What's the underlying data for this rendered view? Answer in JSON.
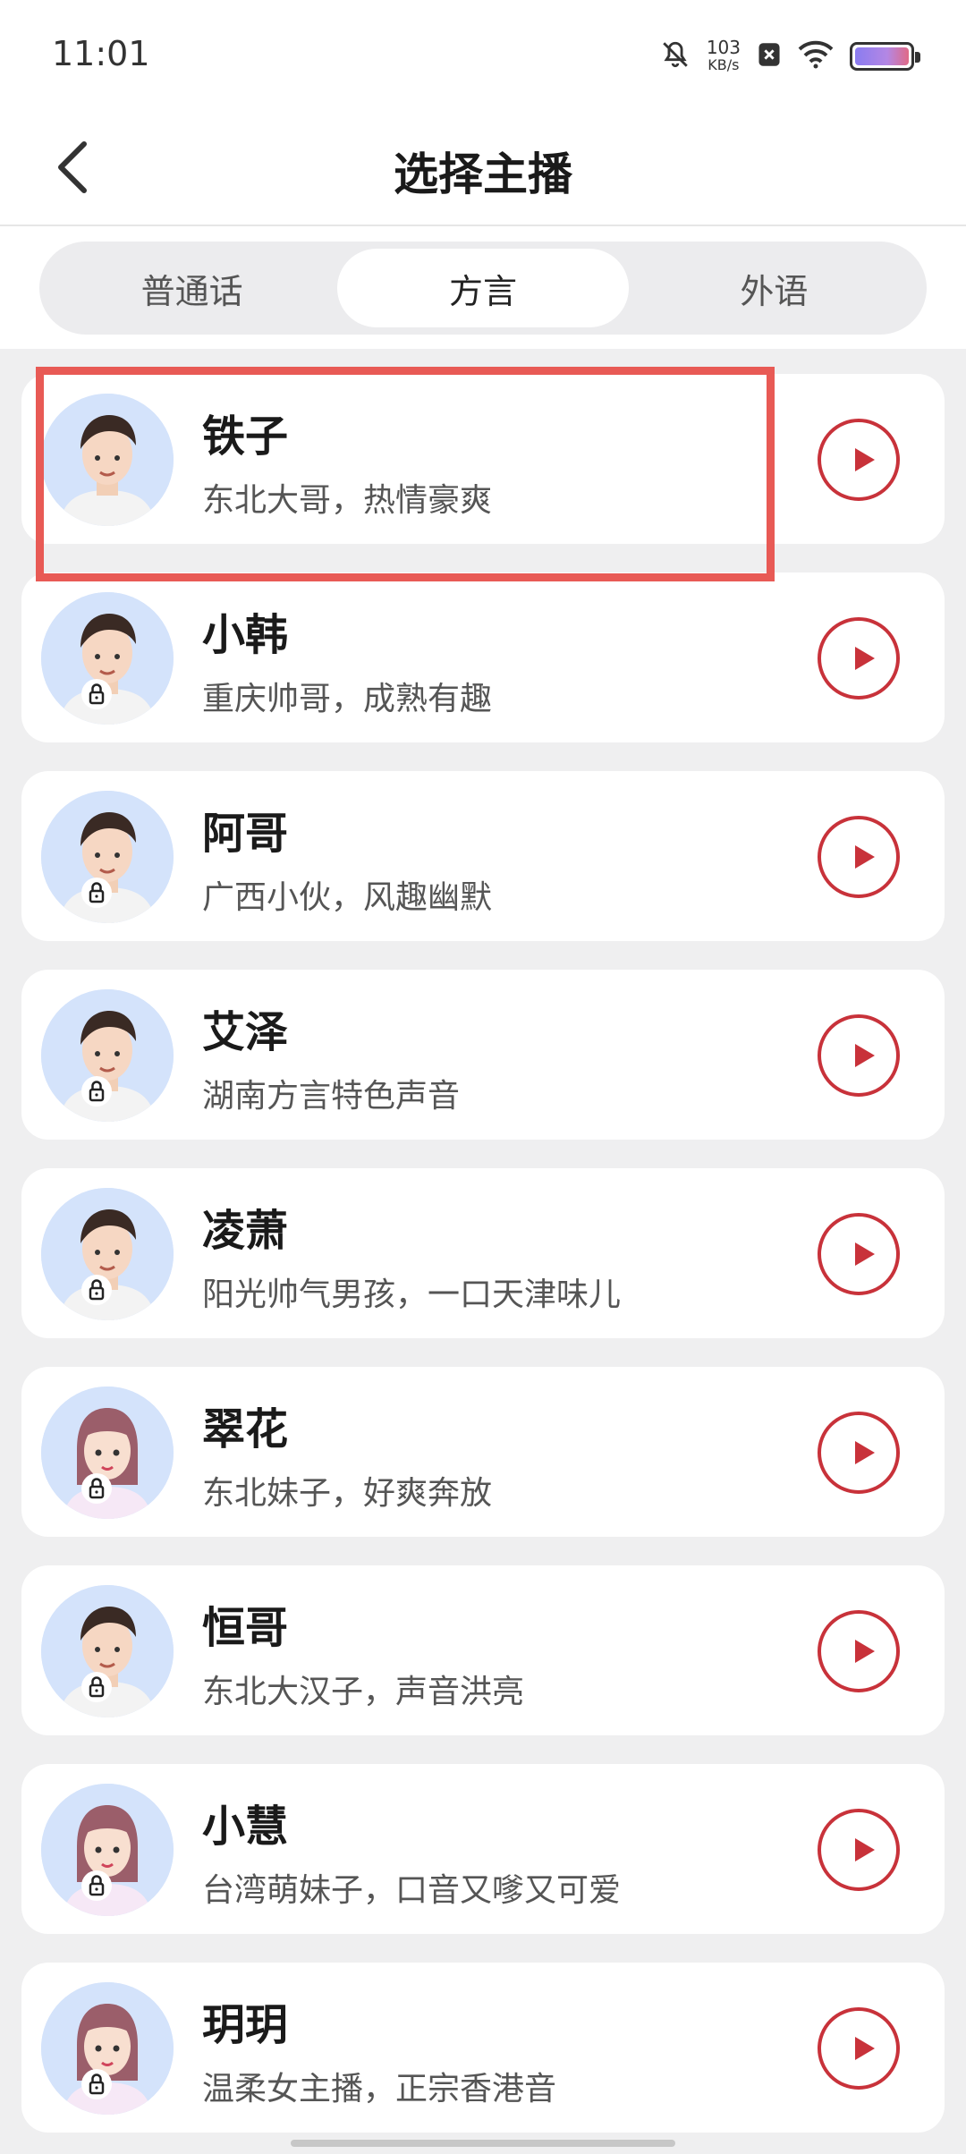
{
  "status_bar": {
    "time": "11:01",
    "speed_value": "103",
    "speed_unit": "KB/s",
    "icons": [
      "mute-bell-icon",
      "x-badge-icon",
      "wifi-icon",
      "battery-icon"
    ]
  },
  "header": {
    "title": "选择主播",
    "back_icon": "chevron-left-icon"
  },
  "tabs": [
    {
      "label": "普通话",
      "active": false
    },
    {
      "label": "方言",
      "active": true
    },
    {
      "label": "外语",
      "active": false
    }
  ],
  "anchors": [
    {
      "name": "铁子",
      "desc": "东北大哥，热情豪爽",
      "locked": false,
      "gender": "male"
    },
    {
      "name": "小韩",
      "desc": "重庆帅哥，成熟有趣",
      "locked": true,
      "gender": "male"
    },
    {
      "name": "阿哥",
      "desc": "广西小伙，风趣幽默",
      "locked": true,
      "gender": "male"
    },
    {
      "name": "艾泽",
      "desc": "湖南方言特色声音",
      "locked": true,
      "gender": "male"
    },
    {
      "name": "凌萧",
      "desc": "阳光帅气男孩，一口天津味儿",
      "locked": true,
      "gender": "male"
    },
    {
      "name": "翠花",
      "desc": "东北妹子，好爽奔放",
      "locked": true,
      "gender": "female"
    },
    {
      "name": "恒哥",
      "desc": "东北大汉子，声音洪亮",
      "locked": true,
      "gender": "male"
    },
    {
      "name": "小慧",
      "desc": "台湾萌妹子，口音又嗲又可爱",
      "locked": true,
      "gender": "female"
    },
    {
      "name": "玥玥",
      "desc": "温柔女主播，正宗香港音",
      "locked": true,
      "gender": "female"
    }
  ],
  "colors": {
    "accent": "#c8323a",
    "highlight": "#e85a55",
    "avatar_bg": "#d4e3fb"
  }
}
